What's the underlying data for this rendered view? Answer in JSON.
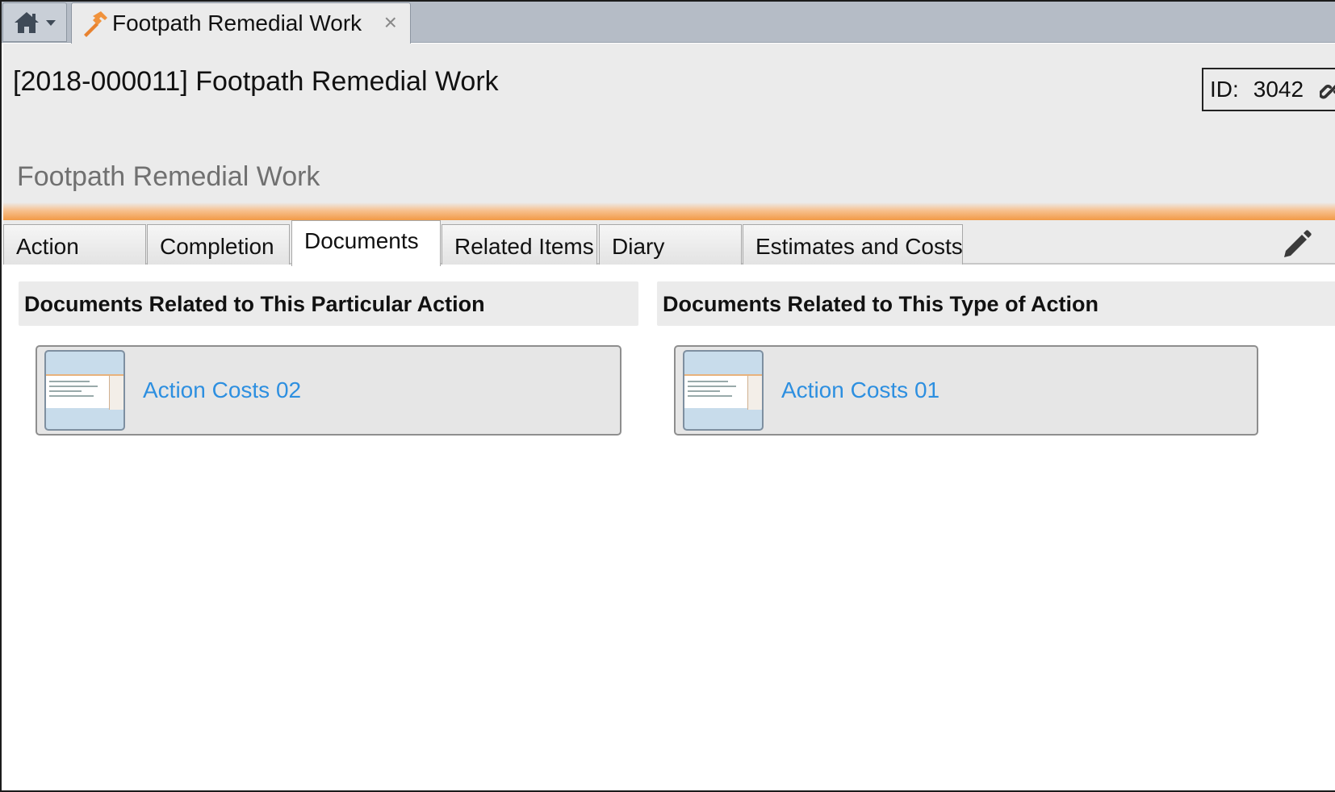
{
  "tabstrip": {
    "home_icon": "home-icon",
    "dropdown_icon": "caret-down-icon",
    "open_tab": {
      "icon": "hammer-icon",
      "title": "Footpath Remedial Work",
      "close_glyph": "×"
    }
  },
  "header": {
    "title": "[2018-000011] Footpath Remedial Work",
    "subtitle": "Footpath Remedial Work",
    "id_label": "ID:",
    "id_value": "3042",
    "link_icon": "link-icon"
  },
  "tabs": [
    {
      "label": "Action",
      "active": false
    },
    {
      "label": "Completion",
      "active": false
    },
    {
      "label": "Documents",
      "active": true
    },
    {
      "label": "Related Items",
      "active": false
    },
    {
      "label": "Diary",
      "active": false
    },
    {
      "label": "Estimates and Costs",
      "active": false
    }
  ],
  "edit_icon": "pencil-icon",
  "panels": [
    {
      "heading": "Documents Related to This Particular Action",
      "documents": [
        {
          "name": "Action Costs 02",
          "thumbnail": "document-thumbnail"
        }
      ]
    },
    {
      "heading": "Documents Related to This Type of Action",
      "documents": [
        {
          "name": "Action Costs 01",
          "thumbnail": "document-thumbnail"
        }
      ]
    }
  ],
  "colors": {
    "accent_orange": "#f29a46",
    "link_blue": "#2d8fe0",
    "header_bg": "#ebebeb",
    "tabstrip_bg": "#b5bcc6"
  }
}
